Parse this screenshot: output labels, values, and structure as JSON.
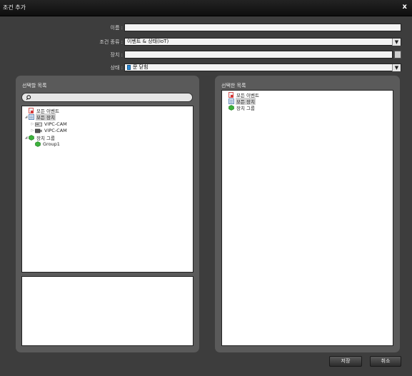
{
  "window": {
    "title": "조건 추가",
    "close": "x"
  },
  "form": {
    "name_label": "이름 :",
    "name_value": "",
    "type_label": "조건 종류 :",
    "type_value": "이벤트 & 상태(IoT)",
    "device_label": "장치 :",
    "device_value": "",
    "state_label": "상태 :",
    "state_value": "문 닫힘"
  },
  "left_panel": {
    "title": "선택할 목록",
    "search_placeholder": "",
    "tree": [
      {
        "label": "모든 이벤트",
        "icon": "event-icon"
      },
      {
        "label": "모든 장치",
        "icon": "device-list-icon",
        "selected": true
      },
      {
        "label": "VIPC-CAM",
        "icon": "dvr-icon"
      },
      {
        "label": "VIPC-CAM",
        "icon": "camera-icon"
      },
      {
        "label": "장치 그룹",
        "icon": "group-icon"
      },
      {
        "label": "Group1",
        "icon": "group-icon"
      }
    ]
  },
  "right_panel": {
    "title": "선택한 목록",
    "tree": [
      {
        "label": "모든 이벤트",
        "icon": "event-icon"
      },
      {
        "label": "모든 장치",
        "icon": "device-list-icon",
        "selected": true
      },
      {
        "label": "장치 그룹",
        "icon": "group-icon"
      }
    ]
  },
  "buttons": {
    "save": "저장",
    "cancel": "취소"
  },
  "colors": {
    "background": "#3d3d3d",
    "panel": "#5a5a5a",
    "titlebar": "#121212",
    "group_green": "#3cb23c",
    "event_red": "#d33a3a"
  }
}
